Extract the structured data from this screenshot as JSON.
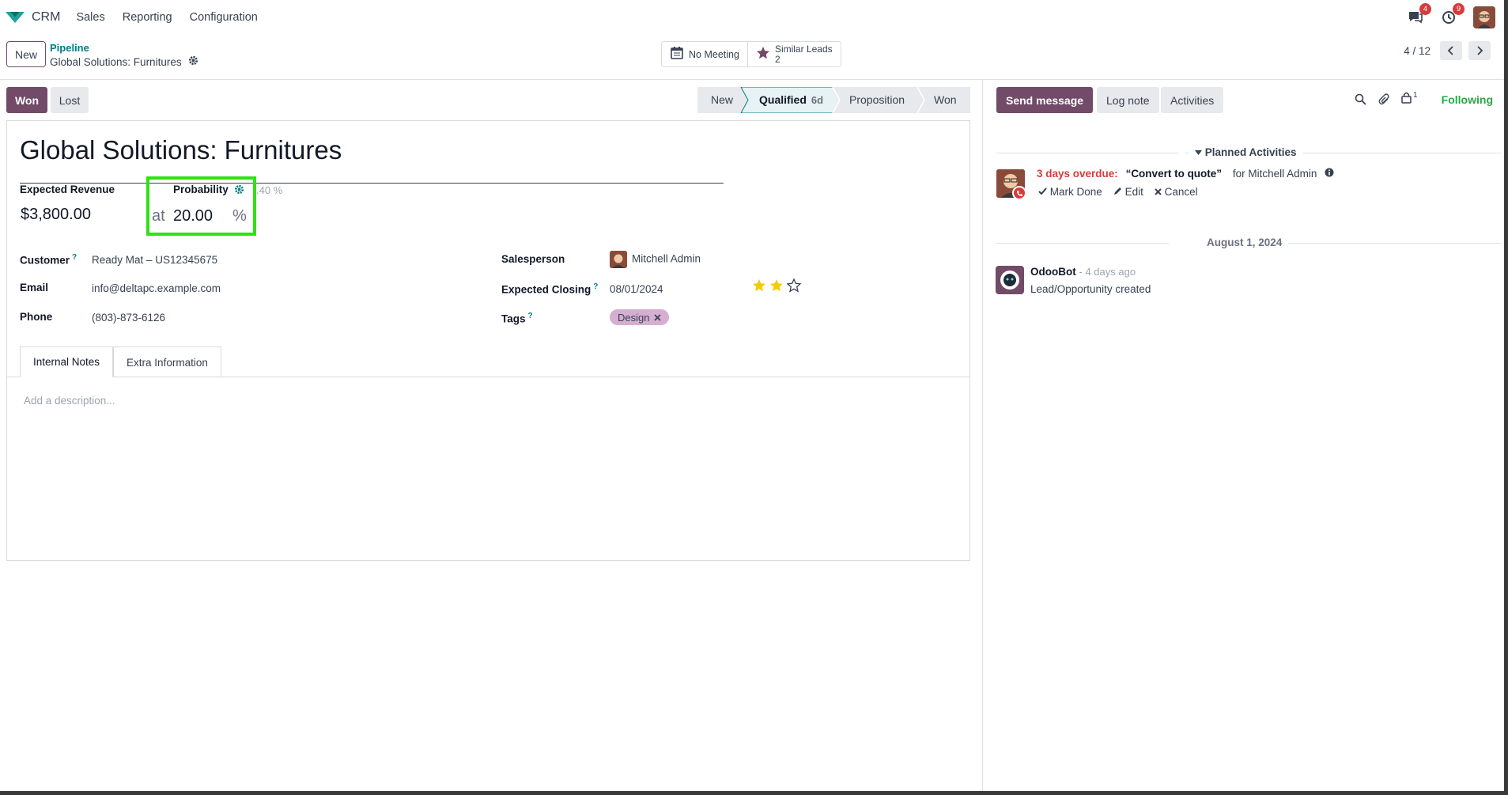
{
  "navbar": {
    "app_name": "CRM",
    "menu": [
      "Sales",
      "Reporting",
      "Configuration"
    ],
    "messages_badge": "4",
    "activities_badge": "9"
  },
  "control": {
    "new_label": "New",
    "breadcrumb": "Pipeline",
    "record_name": "Global Solutions: Furnitures",
    "no_meeting": "No Meeting",
    "similar_leads_label": "Similar Leads",
    "similar_leads_count": "2",
    "pager": "4 / 12"
  },
  "status": {
    "won_label": "Won",
    "lost_label": "Lost",
    "stages": [
      {
        "label": "New"
      },
      {
        "label": "Qualified",
        "days": "6d"
      },
      {
        "label": "Proposition"
      },
      {
        "label": "Won"
      }
    ],
    "active_stage": "Qualified"
  },
  "form": {
    "title": "Global Solutions: Furnitures",
    "expected_revenue_label": "Expected Revenue",
    "expected_revenue": "$3,800.00",
    "probability_label": "Probability",
    "probability_at": "at",
    "probability_value": "20.00",
    "probability_pct": "%",
    "probability_auto": ".40 %",
    "customer_label": "Customer",
    "customer": "Ready Mat – US12345675",
    "email_label": "Email",
    "email": "info@deltapc.example.com",
    "phone_label": "Phone",
    "phone": "(803)-873-6126",
    "salesperson_label": "Salesperson",
    "salesperson": "Mitchell Admin",
    "expected_closing_label": "Expected Closing",
    "expected_closing": "08/01/2024",
    "tags_label": "Tags",
    "tag": "Design",
    "priority_stars": 2,
    "help_mark": "?",
    "tabs": [
      "Internal Notes",
      "Extra Information"
    ],
    "description_placeholder": "Add a description..."
  },
  "chatter": {
    "send_message": "Send message",
    "log_note": "Log note",
    "activities": "Activities",
    "followers_count": "1",
    "following": "Following",
    "planned_title": "Planned Activities",
    "overdue": "3 days overdue:",
    "activity_name": "“Convert to quote”",
    "activity_for": "for Mitchell Admin",
    "mark_done": "Mark Done",
    "edit": "Edit",
    "cancel": "Cancel",
    "date_separator": "August 1, 2024",
    "bot_name": "OdooBot",
    "bot_time": "- 4 days ago",
    "bot_message": "Lead/Opportunity created"
  },
  "colors": {
    "brand": "#714b67",
    "teal": "#017e84",
    "highlight": "#2ee213",
    "overdue": "#d63c3c",
    "following": "#28a745",
    "tag": "#d6aed2"
  }
}
